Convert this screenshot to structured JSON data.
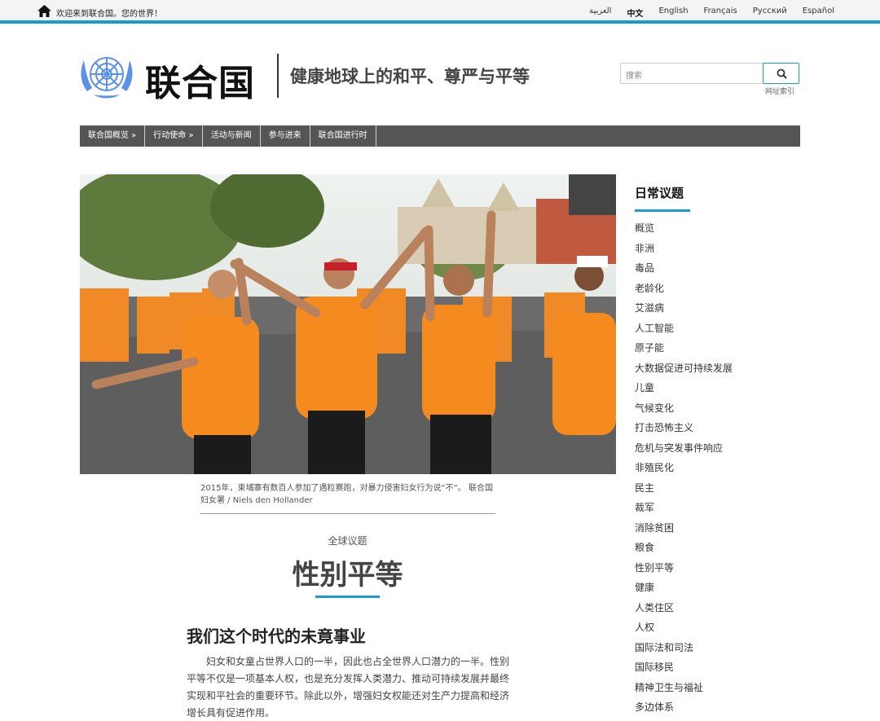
{
  "topbar": {
    "welcome": "欢迎来到联合国。您的世界！",
    "languages": [
      "العربية",
      "中文",
      "English",
      "Français",
      "Русский",
      "Español"
    ],
    "active_language": "中文"
  },
  "header": {
    "brand": "联合国",
    "tagline": "健康地球上的和平、尊严与平等",
    "search_placeholder": "搜索",
    "site_index": "网址索引"
  },
  "nav": {
    "items": [
      "联合国概览 »",
      "行动使命 »",
      "活动与新闻",
      "参与进来",
      "联合国进行时"
    ]
  },
  "main": {
    "caption": "2015年，柬埔寨有数百人参加了遇粒赛跑，对暴力侵害妇女行为说“不”。 联合国妇女署 / Niels den Hollander",
    "kicker": "全球议题",
    "title": "性别平等",
    "subtitle": "我们这个时代的未竟事业",
    "paragraph": "妇女和女童占世界人口的一半，因此也占全世界人口潜力的一半。性别平等不仅是一项基本人权，也是充分发挥人类潜力、推动可持续发展并最终实现和平社会的重要环节。除此以外，增强妇女权能还对生产力提高和经济增长具有促进作用。"
  },
  "sidebar": {
    "title": "日常议题",
    "items": [
      "概览",
      "非洲",
      "毒品",
      "老龄化",
      "艾滋病",
      "人工智能",
      "原子能",
      "大数据促进可持续发展",
      "儿童",
      "气候变化",
      "打击恐怖主义",
      "危机与突发事件响应",
      "非殖民化",
      "民主",
      "裁军",
      "消除贫困",
      "粮食",
      "性别平等",
      "健康",
      "人类住区",
      "人权",
      "国际法和司法",
      "国际移民",
      "精神卫生与福祉",
      "多边体系"
    ]
  },
  "colors": {
    "accent": "#1a9ad6",
    "nav_bg": "#555555",
    "un_blue": "#5b92e5",
    "shirt_orange": "#f58a1f"
  }
}
